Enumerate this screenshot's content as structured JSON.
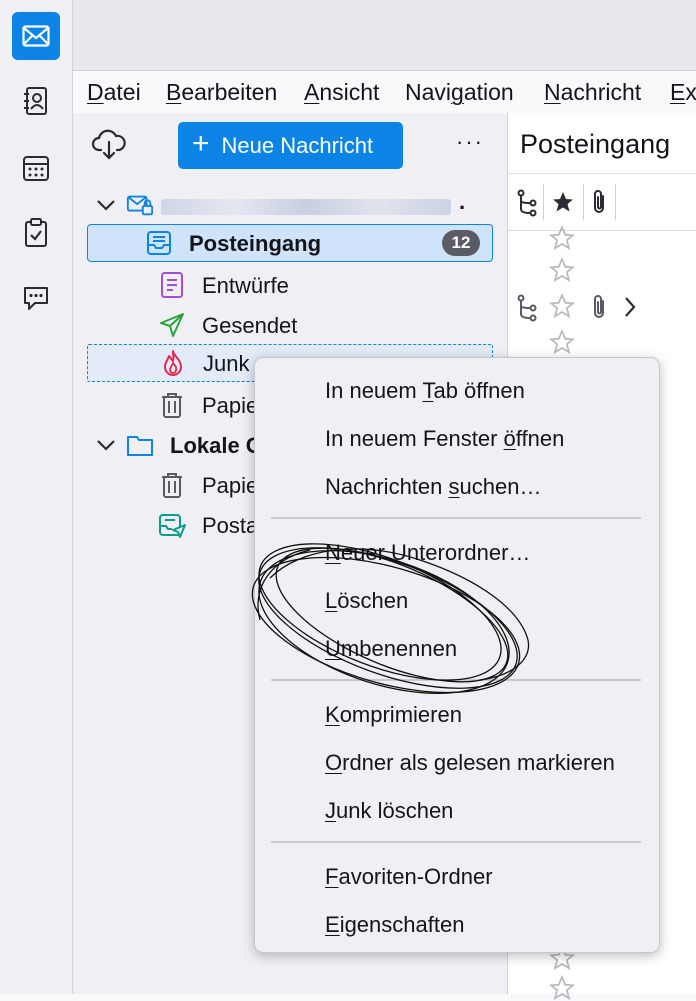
{
  "spaces": [
    {
      "name": "mail",
      "icon": "mail-icon",
      "active": true
    },
    {
      "name": "address-book",
      "icon": "address-book-icon"
    },
    {
      "name": "calendar",
      "icon": "calendar-icon"
    },
    {
      "name": "tasks",
      "icon": "tasks-icon"
    },
    {
      "name": "chat",
      "icon": "chat-icon"
    }
  ],
  "menubar": {
    "datei": "Datei",
    "bearbeiten": "Bearbeiten",
    "ansicht": "Ansicht",
    "navigation": "Navigation",
    "nachricht": "Nachricht",
    "extras": "Ex"
  },
  "folderpane": {
    "new_message": "Neue Nachricht",
    "more": "···",
    "account_name": ".",
    "folders": {
      "inbox": "Posteingang",
      "inbox_unread": "12",
      "drafts": "Entwürfe",
      "sent": "Gesendet",
      "junk": "Junk",
      "trash": "Papie",
      "local": "Lokale O",
      "local_trash": "Papie",
      "local_outbox": "Posta"
    }
  },
  "msgpane": {
    "title": "Posteingang"
  },
  "context_menu": {
    "open_tab": {
      "pre": "In neuem ",
      "key": "T",
      "post": "ab öffnen"
    },
    "open_window": {
      "pre": "In neuem Fenster ",
      "key": "ö",
      "post": "ffnen"
    },
    "search": {
      "pre": "Nachrichten ",
      "key": "s",
      "post": "uchen…"
    },
    "new_subfolder": {
      "pre": "",
      "key": "N",
      "post": "euer Unterordner…"
    },
    "delete": {
      "pre": "",
      "key": "L",
      "post": "öschen"
    },
    "rename": {
      "pre": "",
      "key": "U",
      "post": "mbenennen"
    },
    "compact": {
      "pre": "",
      "key": "K",
      "post": "omprimieren"
    },
    "mark_read": {
      "pre": "",
      "key": "O",
      "post": "rdner als gelesen markieren"
    },
    "empty_junk": {
      "pre": "",
      "key": "J",
      "post": "unk löschen"
    },
    "favorite": {
      "pre": "",
      "key": "F",
      "post": "avoriten-Ordner"
    },
    "properties": {
      "pre": "",
      "key": "E",
      "post": "igenschaften"
    }
  },
  "colors": {
    "accent": "#0b84e5",
    "junk": "#e22850",
    "drafts": "#a44ed6",
    "sent": "#2ea043",
    "trash": "#5b5b66",
    "outbox": "#0a9b8b"
  }
}
